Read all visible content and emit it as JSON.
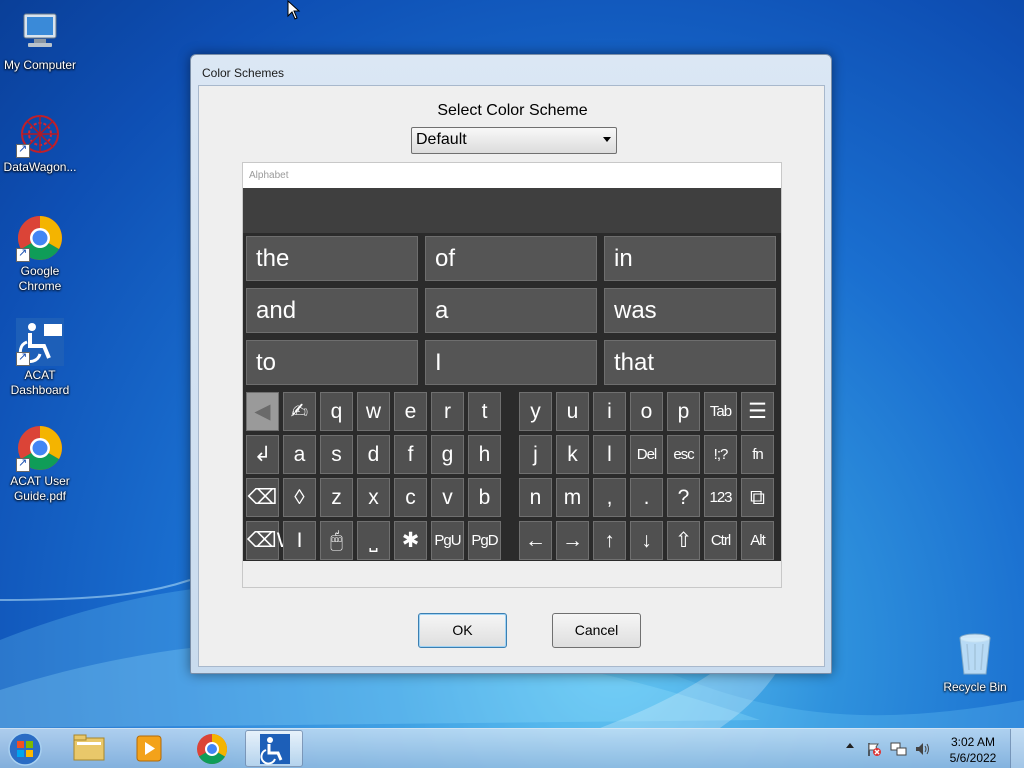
{
  "desktop": {
    "icons": [
      {
        "label": "My Computer"
      },
      {
        "label": "DataWagon..."
      },
      {
        "label": "Google Chrome"
      },
      {
        "label": "ACAT Dashboard"
      },
      {
        "label": "ACAT User Guide.pdf"
      },
      {
        "label": "Recycle Bin"
      }
    ]
  },
  "dialog": {
    "title": "Color Schemes",
    "scheme_label": "Select Color Scheme",
    "scheme_value": "Default",
    "preview_header": "Alphabet",
    "ok_label": "OK",
    "cancel_label": "Cancel"
  },
  "keyboard": {
    "words": [
      "the",
      "of",
      "in",
      "and",
      "a",
      "was",
      "to",
      "I",
      "that"
    ],
    "rows": [
      [
        "◀",
        "✍",
        "q",
        "w",
        "e",
        "r",
        "t",
        "y",
        "u",
        "i",
        "o",
        "p",
        "Tab",
        "☰"
      ],
      [
        "↲",
        "a",
        "s",
        "d",
        "f",
        "g",
        "h",
        "j",
        "k",
        "l",
        "Del",
        "esc",
        "!;?",
        "fn"
      ],
      [
        "⌫",
        "◊",
        "z",
        "x",
        "c",
        "v",
        "b",
        "n",
        "m",
        ",",
        ".",
        "?",
        "123",
        "⧉"
      ],
      [
        "⌫W",
        "I",
        "🖱",
        "⎵",
        "✱",
        "PgU",
        "PgD",
        "←",
        "→",
        "↑",
        "↓",
        "⇧",
        "Ctrl",
        "Alt"
      ]
    ]
  },
  "taskbar": {
    "time": "3:02 AM",
    "date": "5/6/2022"
  },
  "colors": {
    "keyboard_bg": "#2b2b2b",
    "key_bg": "#505050",
    "key_text": "#ffffff"
  }
}
